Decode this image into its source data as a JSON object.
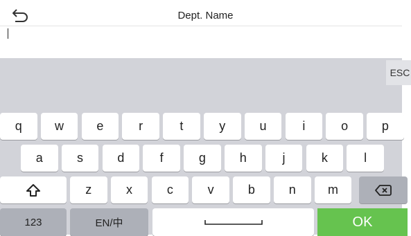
{
  "header": {
    "title": "Dept. Name",
    "back_icon": "back-arrow-icon"
  },
  "input": {
    "value": ""
  },
  "candidate_bar": {
    "esc_label": "ESC"
  },
  "keyboard": {
    "row1": [
      "q",
      "w",
      "e",
      "r",
      "t",
      "y",
      "u",
      "i",
      "o",
      "p"
    ],
    "row2": [
      "a",
      "s",
      "d",
      "f",
      "g",
      "h",
      "j",
      "k",
      "l"
    ],
    "row3": [
      "z",
      "x",
      "c",
      "v",
      "b",
      "n",
      "m"
    ],
    "shift_icon": "shift-arrow-icon",
    "backspace_icon": "backspace-icon",
    "numbers_label": "123",
    "lang_label": "EN/中",
    "space_icon": "space-bar-icon",
    "ok_label": "OK"
  },
  "colors": {
    "keyboard_bg": "#d2d3d9",
    "key_bg": "#ffffff",
    "function_key_bg": "#adb0b8",
    "ok_bg": "#66c34f"
  }
}
